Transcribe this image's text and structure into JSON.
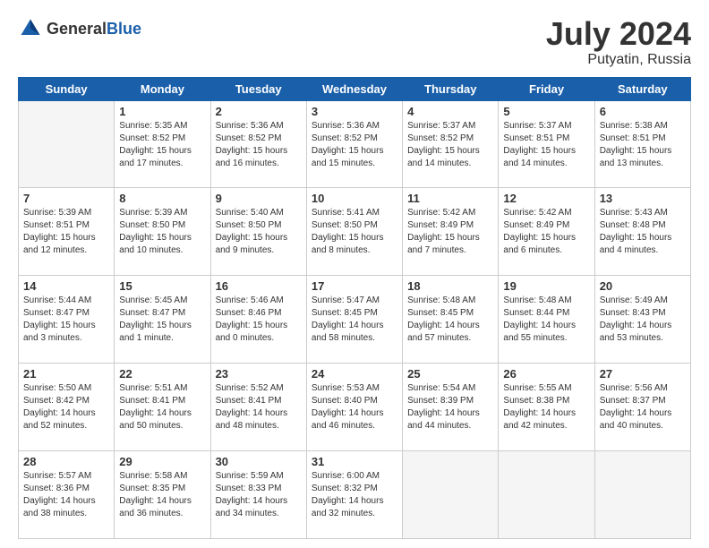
{
  "header": {
    "logo_general": "General",
    "logo_blue": "Blue",
    "month_year": "July 2024",
    "location": "Putyatin, Russia"
  },
  "weekdays": [
    "Sunday",
    "Monday",
    "Tuesday",
    "Wednesday",
    "Thursday",
    "Friday",
    "Saturday"
  ],
  "weeks": [
    [
      {
        "day": "",
        "empty": true
      },
      {
        "day": "1",
        "sunrise": "5:35 AM",
        "sunset": "8:52 PM",
        "daylight": "15 hours and 17 minutes."
      },
      {
        "day": "2",
        "sunrise": "5:36 AM",
        "sunset": "8:52 PM",
        "daylight": "15 hours and 16 minutes."
      },
      {
        "day": "3",
        "sunrise": "5:36 AM",
        "sunset": "8:52 PM",
        "daylight": "15 hours and 15 minutes."
      },
      {
        "day": "4",
        "sunrise": "5:37 AM",
        "sunset": "8:52 PM",
        "daylight": "15 hours and 14 minutes."
      },
      {
        "day": "5",
        "sunrise": "5:37 AM",
        "sunset": "8:51 PM",
        "daylight": "15 hours and 14 minutes."
      },
      {
        "day": "6",
        "sunrise": "5:38 AM",
        "sunset": "8:51 PM",
        "daylight": "15 hours and 13 minutes."
      }
    ],
    [
      {
        "day": "7",
        "sunrise": "5:39 AM",
        "sunset": "8:51 PM",
        "daylight": "15 hours and 12 minutes."
      },
      {
        "day": "8",
        "sunrise": "5:39 AM",
        "sunset": "8:50 PM",
        "daylight": "15 hours and 10 minutes."
      },
      {
        "day": "9",
        "sunrise": "5:40 AM",
        "sunset": "8:50 PM",
        "daylight": "15 hours and 9 minutes."
      },
      {
        "day": "10",
        "sunrise": "5:41 AM",
        "sunset": "8:50 PM",
        "daylight": "15 hours and 8 minutes."
      },
      {
        "day": "11",
        "sunrise": "5:42 AM",
        "sunset": "8:49 PM",
        "daylight": "15 hours and 7 minutes."
      },
      {
        "day": "12",
        "sunrise": "5:42 AM",
        "sunset": "8:49 PM",
        "daylight": "15 hours and 6 minutes."
      },
      {
        "day": "13",
        "sunrise": "5:43 AM",
        "sunset": "8:48 PM",
        "daylight": "15 hours and 4 minutes."
      }
    ],
    [
      {
        "day": "14",
        "sunrise": "5:44 AM",
        "sunset": "8:47 PM",
        "daylight": "15 hours and 3 minutes."
      },
      {
        "day": "15",
        "sunrise": "5:45 AM",
        "sunset": "8:47 PM",
        "daylight": "15 hours and 1 minute."
      },
      {
        "day": "16",
        "sunrise": "5:46 AM",
        "sunset": "8:46 PM",
        "daylight": "15 hours and 0 minutes."
      },
      {
        "day": "17",
        "sunrise": "5:47 AM",
        "sunset": "8:45 PM",
        "daylight": "14 hours and 58 minutes."
      },
      {
        "day": "18",
        "sunrise": "5:48 AM",
        "sunset": "8:45 PM",
        "daylight": "14 hours and 57 minutes."
      },
      {
        "day": "19",
        "sunrise": "5:48 AM",
        "sunset": "8:44 PM",
        "daylight": "14 hours and 55 minutes."
      },
      {
        "day": "20",
        "sunrise": "5:49 AM",
        "sunset": "8:43 PM",
        "daylight": "14 hours and 53 minutes."
      }
    ],
    [
      {
        "day": "21",
        "sunrise": "5:50 AM",
        "sunset": "8:42 PM",
        "daylight": "14 hours and 52 minutes."
      },
      {
        "day": "22",
        "sunrise": "5:51 AM",
        "sunset": "8:41 PM",
        "daylight": "14 hours and 50 minutes."
      },
      {
        "day": "23",
        "sunrise": "5:52 AM",
        "sunset": "8:41 PM",
        "daylight": "14 hours and 48 minutes."
      },
      {
        "day": "24",
        "sunrise": "5:53 AM",
        "sunset": "8:40 PM",
        "daylight": "14 hours and 46 minutes."
      },
      {
        "day": "25",
        "sunrise": "5:54 AM",
        "sunset": "8:39 PM",
        "daylight": "14 hours and 44 minutes."
      },
      {
        "day": "26",
        "sunrise": "5:55 AM",
        "sunset": "8:38 PM",
        "daylight": "14 hours and 42 minutes."
      },
      {
        "day": "27",
        "sunrise": "5:56 AM",
        "sunset": "8:37 PM",
        "daylight": "14 hours and 40 minutes."
      }
    ],
    [
      {
        "day": "28",
        "sunrise": "5:57 AM",
        "sunset": "8:36 PM",
        "daylight": "14 hours and 38 minutes."
      },
      {
        "day": "29",
        "sunrise": "5:58 AM",
        "sunset": "8:35 PM",
        "daylight": "14 hours and 36 minutes."
      },
      {
        "day": "30",
        "sunrise": "5:59 AM",
        "sunset": "8:33 PM",
        "daylight": "14 hours and 34 minutes."
      },
      {
        "day": "31",
        "sunrise": "6:00 AM",
        "sunset": "8:32 PM",
        "daylight": "14 hours and 32 minutes."
      },
      {
        "day": "",
        "empty": true
      },
      {
        "day": "",
        "empty": true
      },
      {
        "day": "",
        "empty": true
      }
    ]
  ]
}
